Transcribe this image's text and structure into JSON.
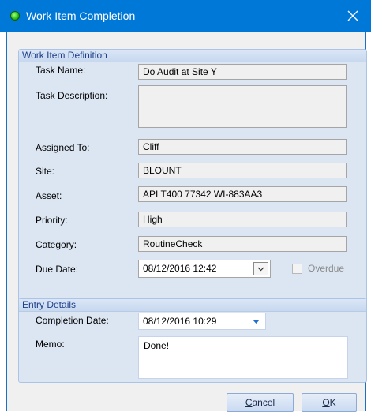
{
  "window": {
    "title": "Work Item Completion"
  },
  "definition": {
    "header": "Work Item Definition",
    "task_name_label": "Task Name:",
    "task_name": "Do Audit at Site Y",
    "task_description_label": "Task Description:",
    "task_description": "",
    "assigned_to_label": "Assigned To:",
    "assigned_to": "Cliff",
    "site_label": "Site:",
    "site": "BLOUNT",
    "asset_label": "Asset:",
    "asset": "API T400 77342 WI-883AA3",
    "priority_label": "Priority:",
    "priority": "High",
    "category_label": "Category:",
    "category": "RoutineCheck",
    "due_date_label": "Due Date:",
    "due_date": "08/12/2016  12:42",
    "overdue_label": "Overdue"
  },
  "entry": {
    "header": "Entry Details",
    "completion_date_label": "Completion Date:",
    "completion_date": "08/12/2016  10:29",
    "memo_label": "Memo:",
    "memo": "Done!"
  },
  "buttons": {
    "cancel_first": "C",
    "cancel_rest": "ancel",
    "ok_first": "O",
    "ok_rest": "K"
  },
  "colors": {
    "titlebar": "#0078d7",
    "group_background": "#dce6f2",
    "group_header_text": "#1e3f8a",
    "button_border": "#8caad3"
  }
}
